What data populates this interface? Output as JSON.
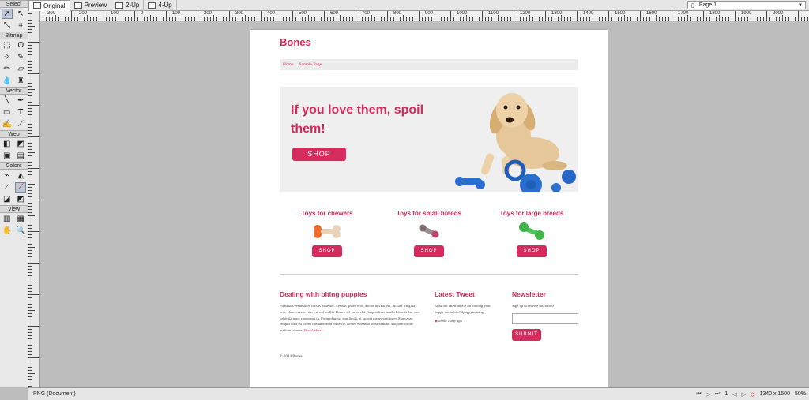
{
  "app": {
    "tabs": [
      {
        "label": "Original",
        "active": true
      },
      {
        "label": "Preview",
        "active": false
      },
      {
        "label": "2-Up",
        "active": false
      },
      {
        "label": "4-Up",
        "active": false
      }
    ],
    "page_selector": "Page 1",
    "ruler_labels": [
      "-300",
      "-200",
      "-100",
      "0",
      "100",
      "200",
      "300",
      "400",
      "500",
      "600",
      "700",
      "800",
      "900",
      "1000",
      "1100",
      "1200",
      "1300",
      "1400",
      "1500",
      "1600",
      "1700",
      "1800",
      "1900",
      "2000",
      "2100"
    ]
  },
  "tools": {
    "sections": [
      "Select",
      "Bitmap",
      "Vector",
      "Web",
      "Colors",
      "View"
    ]
  },
  "status": {
    "doc_type": "PNG (Document)",
    "page_num": "1",
    "dimensions": "1340 x 1500",
    "zoom": "50%"
  },
  "site": {
    "logo": "Bones",
    "nav": [
      "Home",
      "Sample Page"
    ],
    "hero": {
      "headline": "If you love them, spoil them!",
      "button": "SHOP"
    },
    "categories": [
      {
        "title": "Toys for chewers",
        "button": "SHOP"
      },
      {
        "title": "Toys for small breeds",
        "button": "SHOP"
      },
      {
        "title": "Toys for large breeds",
        "button": "SHOP"
      }
    ],
    "blog": {
      "title": "Dealing with biting puppies",
      "body": "Phasellus vestibulum cursus molestie. Aenean ipsum eros, auctor ut velit vel, dictum fringilla orci. Nunc cursus vitae est sed mollis. Donec vel tortor elit. Suspendisse iaculis lobortis dui, nec vehicula nunc consequat in. Proin pharetra erat ligula, at lacinia metus sagittis et. Maecenas tempor urna eu lorem condimentum molestie. Donec euismod porta blandit. Aliquam varius pretium viverra.",
      "read_more": "[Read More]"
    },
    "tweet": {
      "title": "Latest Tweet",
      "body": "Read our latest article on training your puppy not to bite! #puppytraining",
      "time": "about 1 day ago"
    },
    "newsletter": {
      "title": "Newsletter",
      "text": "Sign up to receive discounts!",
      "button": "SUBMIT"
    },
    "footer": "© 2014 Bones."
  }
}
